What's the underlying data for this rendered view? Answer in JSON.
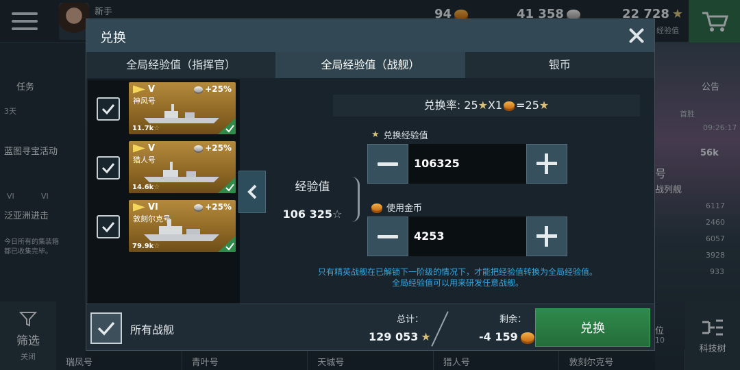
{
  "background": {
    "player_rank": "新手",
    "resources": {
      "gold": "94",
      "silver": "41 358",
      "free_xp": "22 728"
    },
    "free_xp_caption": "经验值",
    "left_menu": {
      "tasks": "任务",
      "blueprint_event": "蓝图寻宝活动",
      "blueprint_timer": "3天",
      "pan_asia_event": "泛亚洲进击",
      "pan_asia_tiers": [
        "VI",
        "VI"
      ],
      "notice_line1": "今日所有的集装箱",
      "notice_line2": "都已收集完毕。"
    },
    "right_menu": {
      "announcement": "公告",
      "first_win": "首胜",
      "first_win_timer": "09:26:17",
      "ship_xp": "56k",
      "ship_class_fragment": "号",
      "ship_type_fragment": "战列舰",
      "stats": [
        "6117",
        "2460",
        "6057",
        "3928",
        "933"
      ],
      "fragment_a": "位",
      "fragment_b": "10"
    },
    "filter": {
      "label": "筛选",
      "state": "关闭"
    },
    "tech_tree": "科技树",
    "bottom_ships": [
      "瑞凤号",
      "青叶号",
      "天城号",
      "猎人号",
      "敦刻尔克号"
    ]
  },
  "modal": {
    "title": "兑换",
    "tabs": [
      {
        "label": "全局经验值（指挥官）",
        "active": false
      },
      {
        "label": "全局经验值（战舰）",
        "active": true
      },
      {
        "label": "银币",
        "active": false
      }
    ],
    "ships": [
      {
        "tier": "V",
        "name": "神风号",
        "bonus": "+25%",
        "xp": "11.7k",
        "checked": true
      },
      {
        "tier": "V",
        "name": "猎人号",
        "bonus": "+25%",
        "xp": "14.6k",
        "checked": true
      },
      {
        "tier": "VI",
        "name": "敦刻尔克号",
        "bonus": "+25%",
        "xp": "79.9k",
        "checked": true
      }
    ],
    "rate": {
      "label": "兑换率:",
      "a": "25",
      "x1": "X1",
      "b": "=25"
    },
    "xp_label": "经验值",
    "xp_value": "106 325",
    "convert_xp": {
      "label": "兑换经验值",
      "value": "106325"
    },
    "use_gold": {
      "label": "使用金币",
      "value": "4253"
    },
    "note_line1": "只有精英战舰在已解锁下一阶级的情况下，才能把经验值转换为全局经验值。",
    "note_line2": "全局经验值可以用来研发任意战舰。",
    "footer": {
      "all_ships": "所有战舰",
      "total_label": "总计：",
      "total_value": "129 053",
      "remaining_label": "剩余：",
      "remaining_value": "-4 159",
      "exchange_button": "兑换"
    }
  },
  "colors": {
    "accent_green": "#2f8a4b",
    "note_blue": "#38a7e0",
    "card_gold": "#b48a3c"
  }
}
